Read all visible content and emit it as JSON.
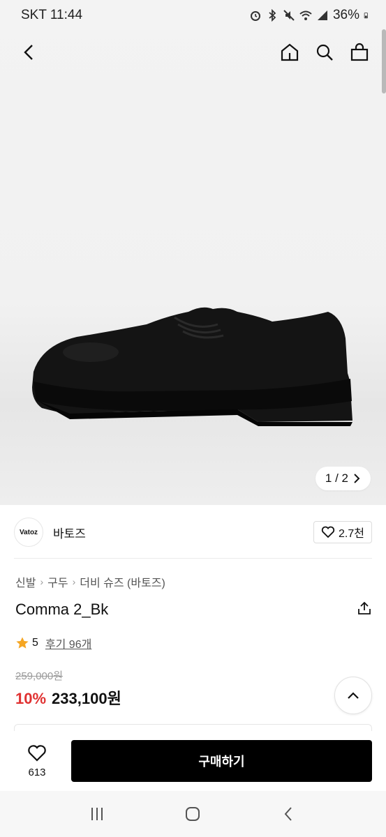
{
  "status_bar": {
    "carrier_time": "SKT 11:44",
    "battery": "36%",
    "icons": [
      "alarm-icon",
      "bluetooth-icon",
      "mute-icon",
      "wifi-icon",
      "signal-icon",
      "battery-icon"
    ]
  },
  "app_bar": {
    "icons": [
      "back-icon",
      "home-icon",
      "search-icon",
      "bag-icon"
    ]
  },
  "gallery": {
    "pager": "1 / 2",
    "pager_icon": "chevron-right-icon"
  },
  "brand": {
    "logo_text": "Vatoz",
    "name": "바토즈",
    "like_count": "2.7천",
    "like_icon": "heart-outline-icon"
  },
  "breadcrumb": {
    "items": [
      "신발",
      "구두",
      "더비 슈즈 (바토즈)"
    ],
    "separator": "›"
  },
  "product": {
    "title": "Comma 2_Bk",
    "share_icon": "share-icon",
    "rating": "5",
    "review_label": "후기 96개",
    "original_price": "259,000원",
    "discount": "10%",
    "price": "233,100원"
  },
  "bottom_bar": {
    "wish_count": "613",
    "buy_label": "구매하기"
  },
  "colors": {
    "accent_red": "#e03131",
    "star": "#f5a623",
    "buy_bg": "#000000"
  }
}
